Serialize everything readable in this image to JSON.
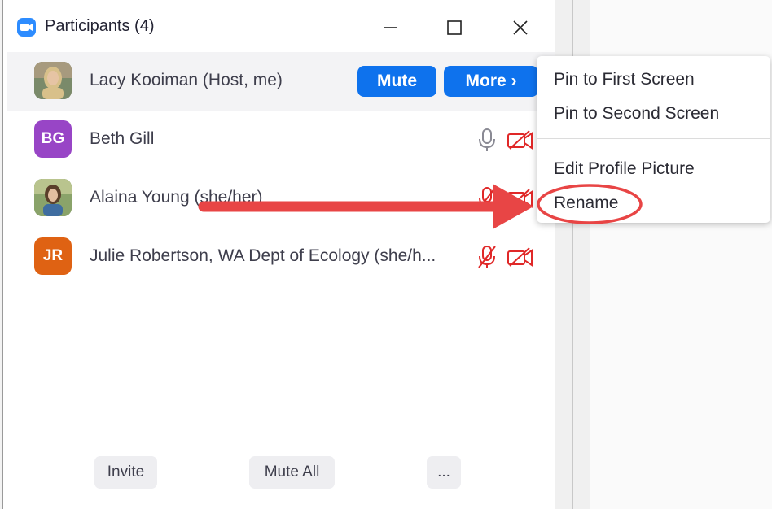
{
  "window": {
    "title": "Participants (4)"
  },
  "participants": [
    {
      "name": "Lacy Kooiman (Host, me)",
      "initials": "",
      "avatar_color": "#8b7a62",
      "mute_label": "Mute",
      "more_label": "More ›"
    },
    {
      "name": "Beth Gill",
      "initials": "BG",
      "avatar_color": "#9845c6"
    },
    {
      "name": "Alaina Young (she/her)",
      "initials": "",
      "avatar_color": "#6f8f5a"
    },
    {
      "name": "Julie Robertson, WA Dept of Ecology (she/h...",
      "initials": "JR",
      "avatar_color": "#df6213"
    }
  ],
  "footer": {
    "invite_label": "Invite",
    "mute_all_label": "Mute All",
    "more_label": "..."
  },
  "context_menu": {
    "items": [
      "Pin to First Screen",
      "Pin to Second Screen",
      "Edit Profile Picture",
      "Rename"
    ]
  },
  "colors": {
    "accent_blue": "#0e72ed",
    "muted_red": "#e02828",
    "annotation_red": "#e84545"
  }
}
